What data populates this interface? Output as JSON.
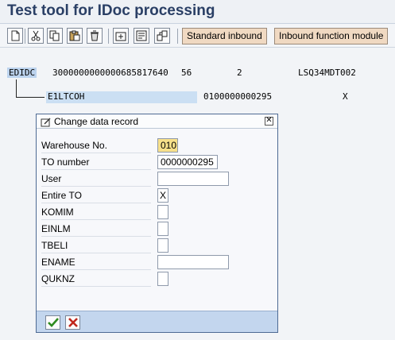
{
  "window": {
    "title": "Test tool for IDoc processing"
  },
  "toolbar": {
    "icons": [
      "new-document-icon",
      "cut-icon",
      "copy-icon",
      "paste-icon",
      "delete-icon",
      "insert-segment-icon",
      "edit-segment-icon",
      "copy-segment-icon"
    ],
    "standard_inbound": "Standard inbound",
    "inbound_function_module": "Inbound function module"
  },
  "tree": {
    "root": {
      "segment": "EDIDC",
      "col1": "3000000000000685817640",
      "col2": "56",
      "col3": "2",
      "col4": "LSQ34MDT002"
    },
    "child": {
      "segment": "E1LTCOH",
      "col1": "0100000000295",
      "col2": "X"
    }
  },
  "dialog": {
    "title": "Change data record",
    "fields": [
      {
        "label": "Warehouse No.",
        "value": "010"
      },
      {
        "label": "TO number",
        "value": "0000000295"
      },
      {
        "label": "User",
        "value": ""
      },
      {
        "label": "Entire TO",
        "value": "X"
      },
      {
        "label": "KOMIM",
        "value": ""
      },
      {
        "label": "EINLM",
        "value": ""
      },
      {
        "label": "TBELI",
        "value": ""
      },
      {
        "label": "ENAME",
        "value": ""
      },
      {
        "label": "QUKNZ",
        "value": ""
      }
    ],
    "icons": {
      "confirm": "checkmark-icon",
      "cancel": "cancel-icon",
      "close": "close-icon"
    },
    "colors": {
      "confirm": "#2e8b1f",
      "cancel": "#c0261c",
      "footer": "#c3d6ee"
    }
  }
}
